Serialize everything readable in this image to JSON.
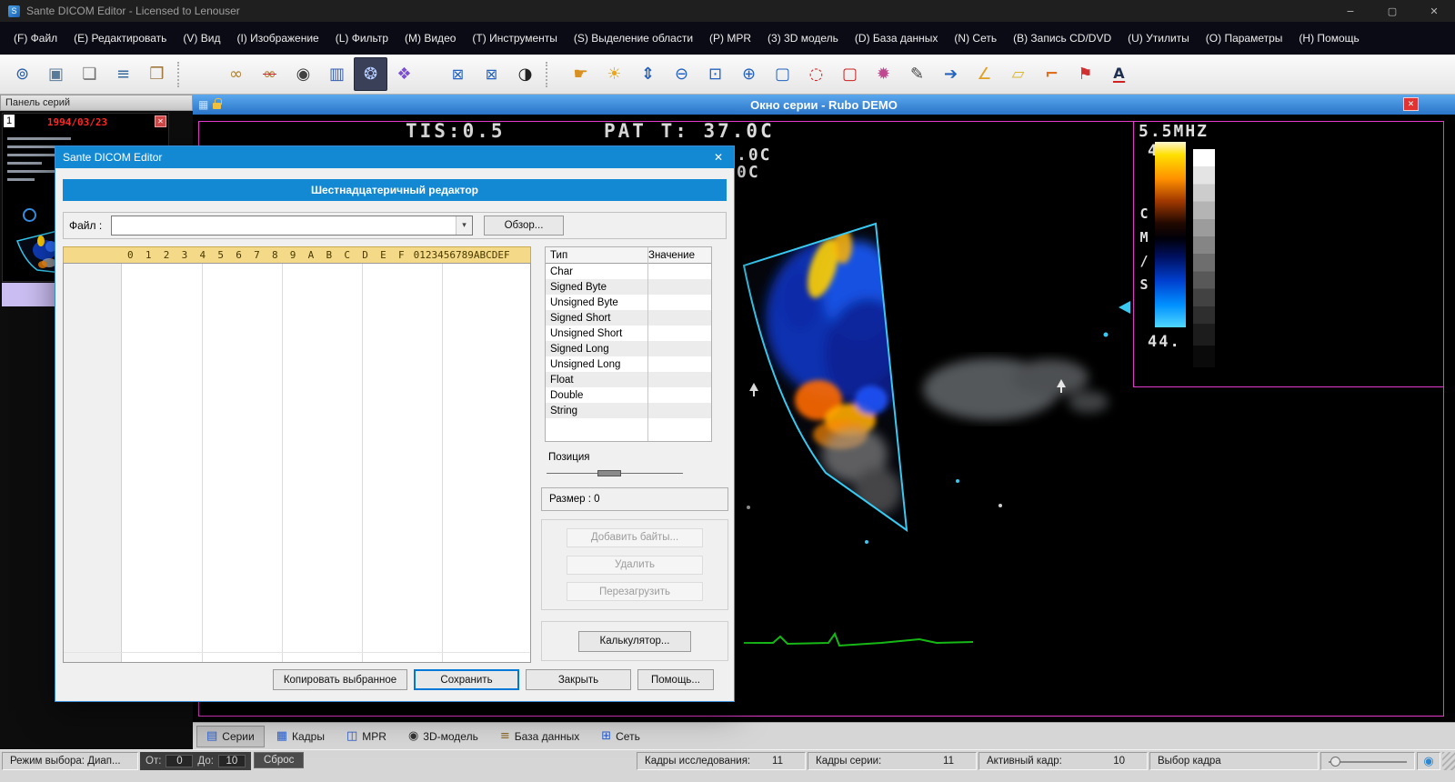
{
  "window": {
    "title": "Sante DICOM Editor - Licensed to Lenouser"
  },
  "icons": {
    "close": "✕",
    "minimize": "−",
    "maximize": "▢",
    "dropdown": "▾",
    "grid": "▦",
    "globe": "◉",
    "app": "S"
  },
  "menu": {
    "items": [
      "(F) Файл",
      "(E) Редактировать",
      "(V) Вид",
      "(I) Изображение",
      "(L) Фильтр",
      "(M) Видео",
      "(T) Инструменты",
      "(S) Выделение области",
      "(P) MPR",
      "(3) 3D модель",
      "(D) База данных",
      "(N) Сеть",
      "(B) Запись CD/DVD",
      "(U) Утилиты",
      "(O) Параметры",
      "(H) Помощь"
    ]
  },
  "toolbar": {
    "group1": [
      {
        "name": "open-study-button",
        "glyph": "⊚"
      },
      {
        "name": "save-study-button",
        "glyph": "▣"
      },
      {
        "name": "export-image-button",
        "glyph": "❏"
      },
      {
        "name": "edit-database-button",
        "glyph": "≡"
      },
      {
        "name": "clipboard-button",
        "glyph": "❒"
      }
    ],
    "group2": [
      {
        "name": "link-series-button",
        "glyph": "∞"
      },
      {
        "name": "unlink-series-button",
        "glyph": "∞"
      },
      {
        "name": "overlay-eye-button",
        "glyph": "◉"
      },
      {
        "name": "compare-columns-button",
        "glyph": "▥"
      },
      {
        "name": "aperture-button",
        "glyph": "❂",
        "active": true
      },
      {
        "name": "palette-button",
        "glyph": "❖"
      }
    ],
    "group3": [
      {
        "name": "flip-horizontal-button",
        "glyph": "⊠"
      },
      {
        "name": "flip-vertical-button",
        "glyph": "⊠"
      },
      {
        "name": "invert-image-button",
        "glyph": "◑"
      }
    ],
    "group4": [
      {
        "name": "pan-hand-button",
        "glyph": "☛"
      },
      {
        "name": "brightness-button",
        "glyph": "☀"
      },
      {
        "name": "window-level-button",
        "glyph": "⇕"
      },
      {
        "name": "zoom-out-button",
        "glyph": "⊖"
      },
      {
        "name": "zoom-region-button",
        "glyph": "⊡"
      },
      {
        "name": "zoom-in-button",
        "glyph": "⊕"
      },
      {
        "name": "select-rect-button",
        "glyph": "▢"
      },
      {
        "name": "select-ellipse-button",
        "glyph": "◌"
      },
      {
        "name": "select-rect-red-button",
        "glyph": "▢"
      },
      {
        "name": "color-sphere-button",
        "glyph": "✹"
      },
      {
        "name": "line-tool-button",
        "glyph": "✎"
      },
      {
        "name": "arrow-tool-button",
        "glyph": "➔"
      },
      {
        "name": "angle-tool-button",
        "glyph": "∠"
      },
      {
        "name": "eraser-tool-button",
        "glyph": "▱"
      },
      {
        "name": "corner-tool-button",
        "glyph": "⌐"
      },
      {
        "name": "flag-tool-button",
        "glyph": "⚑"
      },
      {
        "name": "text-tool-button",
        "glyph": "A"
      }
    ]
  },
  "series_panel": {
    "title": "Панель серий",
    "thumb_index": "1",
    "thumb_date": "1994/03/23"
  },
  "series_window": {
    "title": "Окно серии - Rubo DEMO"
  },
  "ultrasound": {
    "tis": "TIS:0.5",
    "pat": "PAT T: 37.0C",
    "line2": ".0C",
    "line3": "0C",
    "mhz": "5.5MHZ",
    "scale_top": "44.",
    "scale_bottom": "44.",
    "cms": "C\nM\n/\nS"
  },
  "dialog": {
    "title": "Sante DICOM Editor",
    "header": "Шестнадцатеричный редактор",
    "file_label": "Файл :",
    "browse_label": "Обзор...",
    "bytes_header": "0  1  2  3  4  5  6  7  8  9  A  B  C  D  E  F",
    "ascii_header": "0123456789ABCDEF",
    "table": {
      "col_type": "Тип",
      "col_value": "Значение",
      "rows": [
        "Char",
        "Signed Byte",
        "Unsigned Byte",
        "Signed Short",
        "Unsigned Short",
        "Signed Long",
        "Unsigned Long",
        "Float",
        "Double",
        "String"
      ]
    },
    "position_label": "Позиция",
    "size_label": "Размер : 0",
    "buttons": {
      "add": "Добавить байты...",
      "delete": "Удалить",
      "reload": "Перезагрузить",
      "calc": "Калькулятор...",
      "copy": "Копировать выбранное",
      "save": "Сохранить",
      "close": "Закрыть",
      "help": "Помощь..."
    }
  },
  "tabs": {
    "items": [
      {
        "name": "tab-series",
        "label": "Серии",
        "glyph": "▤",
        "active": true
      },
      {
        "name": "tab-frames",
        "label": "Кадры",
        "glyph": "▦"
      },
      {
        "name": "tab-mpr",
        "label": "MPR",
        "glyph": "◫"
      },
      {
        "name": "tab-3d-model",
        "label": "3D-модель",
        "glyph": "◉"
      },
      {
        "name": "tab-database",
        "label": "База данных",
        "glyph": "≡"
      },
      {
        "name": "tab-network",
        "label": "Сеть",
        "glyph": "⊞"
      }
    ]
  },
  "status": {
    "mode": "Режим выбора: Диап...",
    "from_label": "От:",
    "from_value": "0",
    "to_label": "До:",
    "to_value": "10",
    "reset_label": "Сброс",
    "segments": [
      {
        "name": "status-study-frames",
        "label": "Кадры исследования:",
        "value": "11"
      },
      {
        "name": "status-series-frames",
        "label": "Кадры серии:",
        "value": "11"
      },
      {
        "name": "status-active-frame",
        "label": "Активный кадр:",
        "value": "10"
      },
      {
        "name": "status-frame-select",
        "label": "Выбор кадра",
        "value": ""
      }
    ]
  }
}
